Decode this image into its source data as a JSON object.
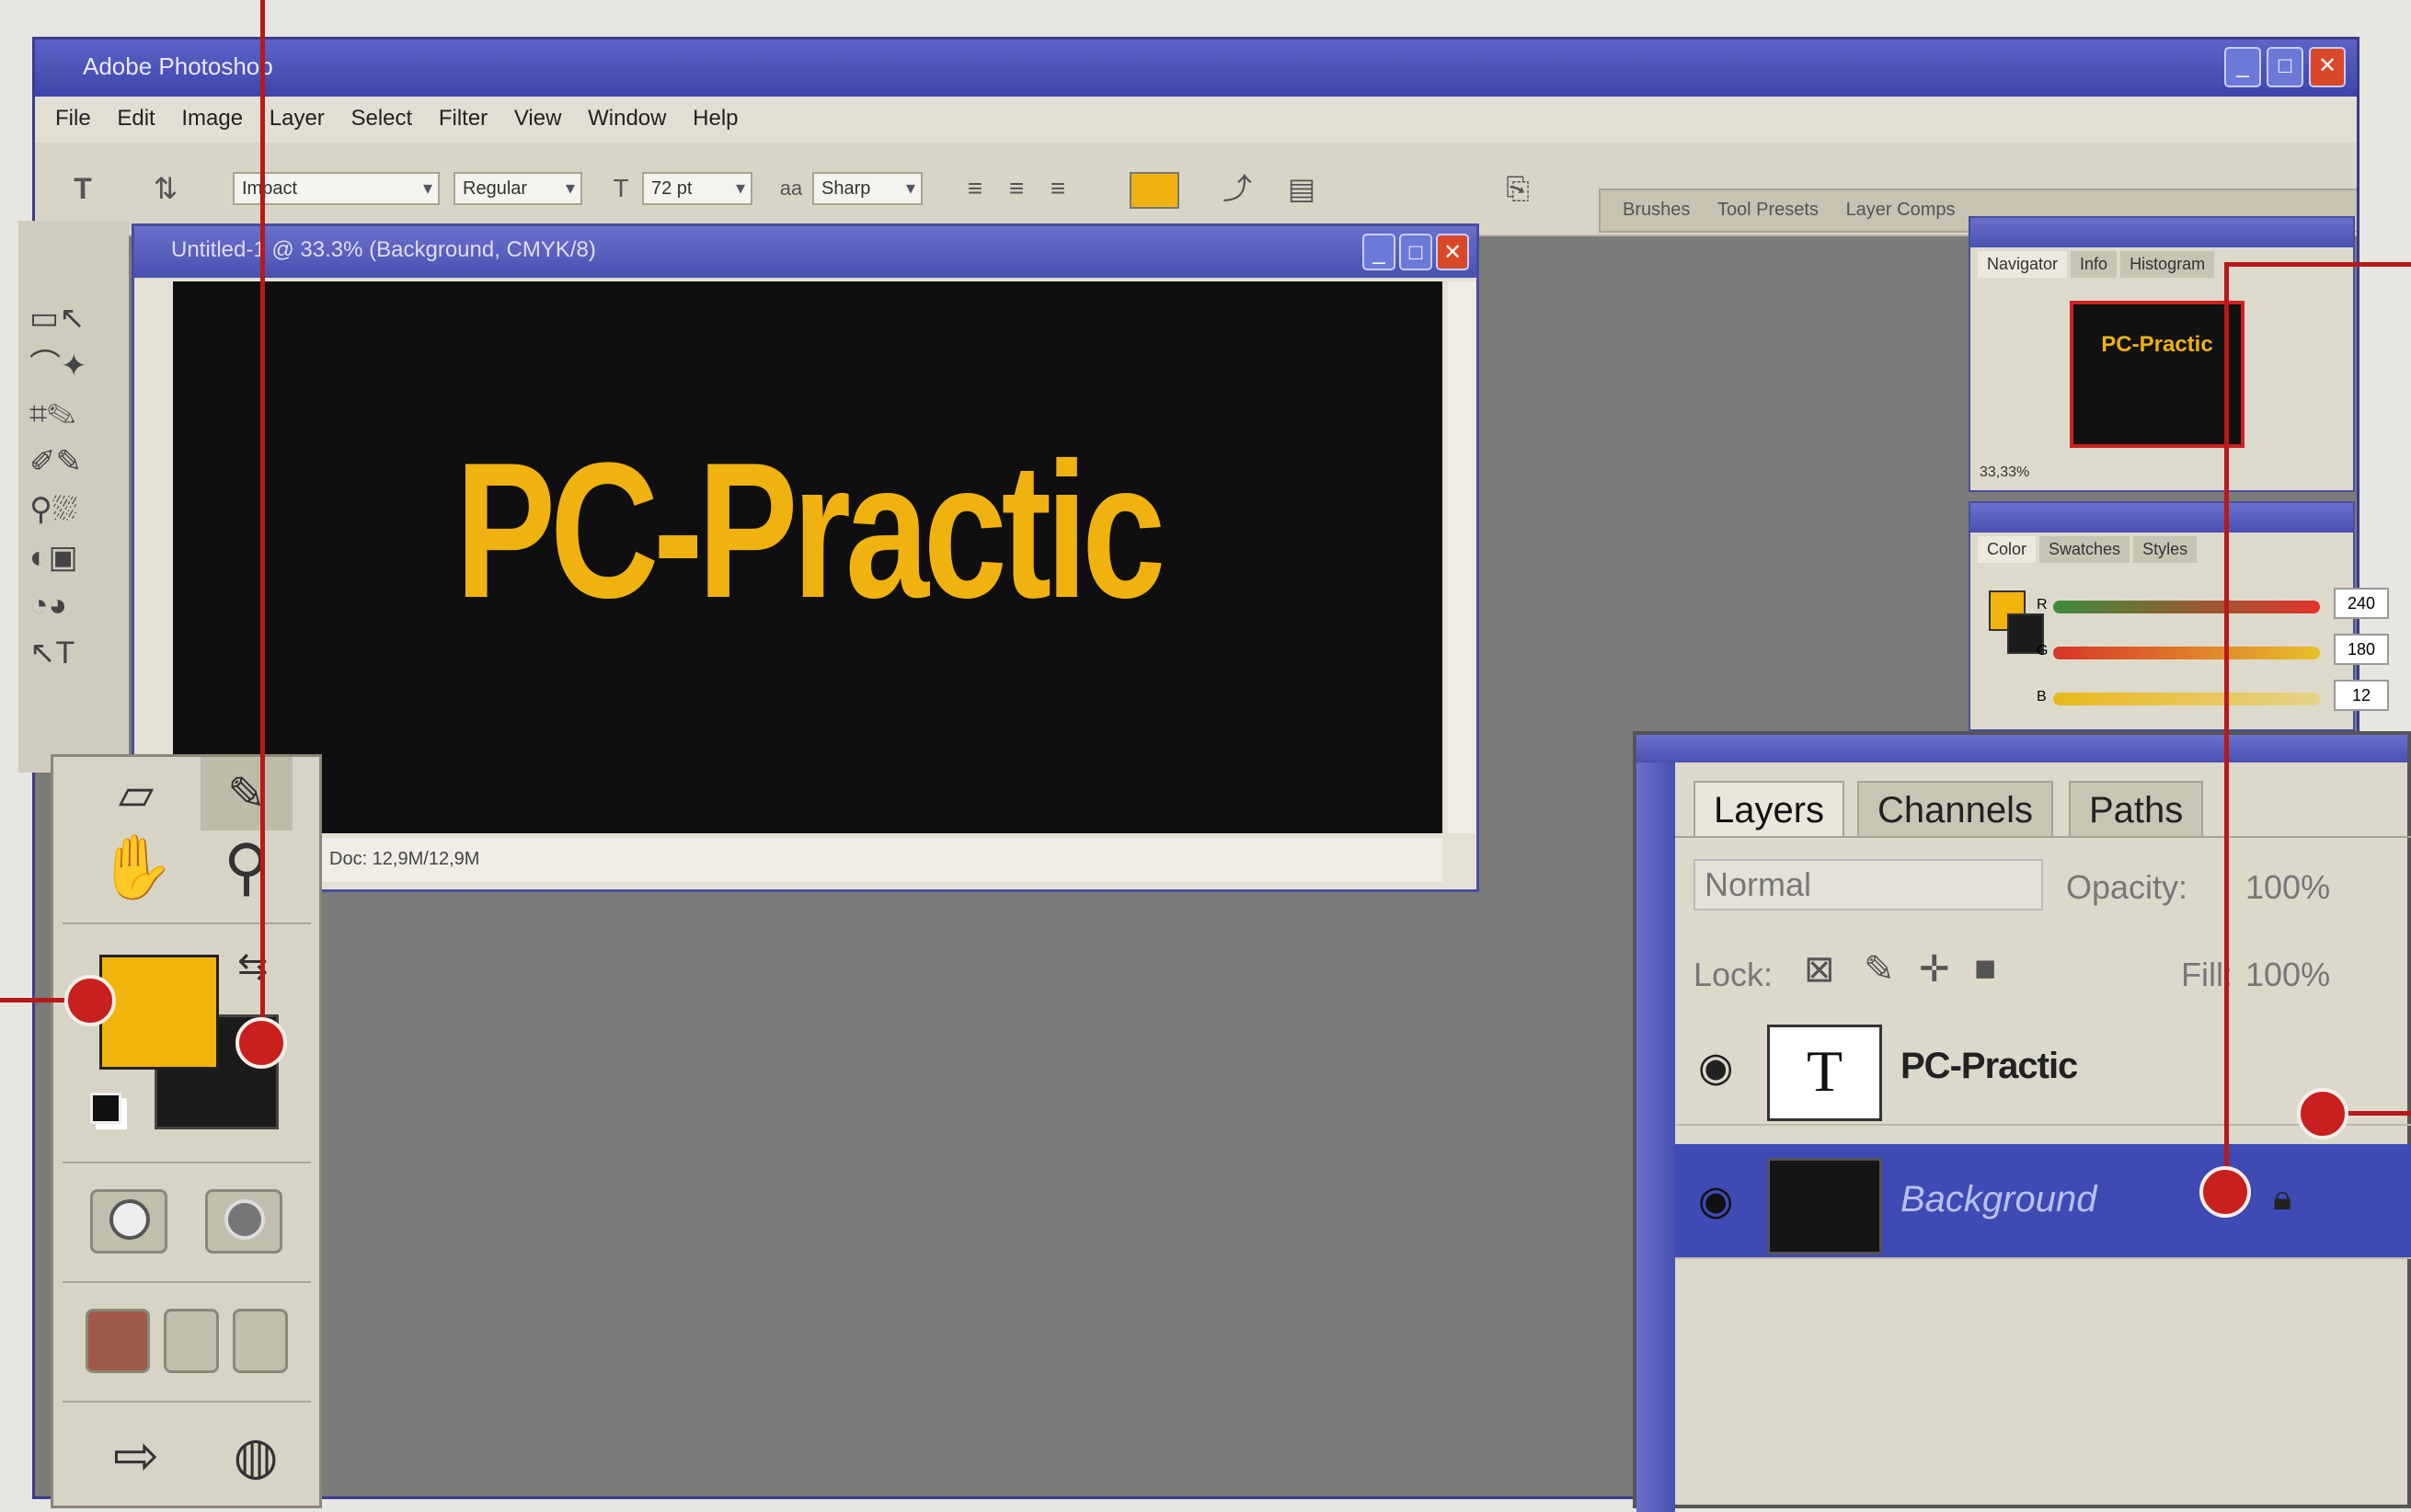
{
  "window": {
    "title": "Adobe Photoshop",
    "buttons": [
      "_",
      "□",
      "✕"
    ]
  },
  "menu": [
    "File",
    "Edit",
    "Image",
    "Layer",
    "Select",
    "Filter",
    "View",
    "Window",
    "Help"
  ],
  "options_bar": {
    "tool_icon": "T",
    "font_family": "Impact",
    "font_style": "Regular",
    "font_size": "72 pt",
    "antialias": "Sharp",
    "color_swatch": "#f0b20f"
  },
  "palette_well": [
    "Brushes",
    "Tool Presets",
    "Layer Comps"
  ],
  "document": {
    "title": "Untitled-1 @ 33.3% (Background, CMYK/8)",
    "canvas_text": "PC-Practic",
    "status": "Doc: 12,9M/12,9M"
  },
  "navigator": {
    "tabs": [
      "Navigator",
      "Info",
      "Histogram"
    ],
    "zoom": "33,33%",
    "thumb_text": "PC-Practic"
  },
  "color_panel": {
    "tabs": [
      "Color",
      "Swatches",
      "Styles"
    ],
    "channels": [
      {
        "label": "R",
        "value": "240",
        "color": "#e0332b"
      },
      {
        "label": "G",
        "value": "180",
        "color": "#d8a01a"
      },
      {
        "label": "B",
        "value": "12",
        "color": "#e6c44a"
      }
    ]
  },
  "layers_panel": {
    "tabs": [
      "Layers",
      "Channels",
      "Paths"
    ],
    "blend_mode": "Normal",
    "opacity_label": "Opacity:",
    "opacity_value": "100%",
    "lock_label": "Lock:",
    "fill_label": "Fill:",
    "fill_value": "100%",
    "layers": [
      {
        "name": "PC-Practic",
        "thumb": "T",
        "selected": false
      },
      {
        "name": "Background",
        "thumb": "",
        "selected": true
      }
    ]
  },
  "colors": {
    "foreground": "#f2b30d",
    "background": "#1b1b1b",
    "accent": "#b8191a"
  }
}
